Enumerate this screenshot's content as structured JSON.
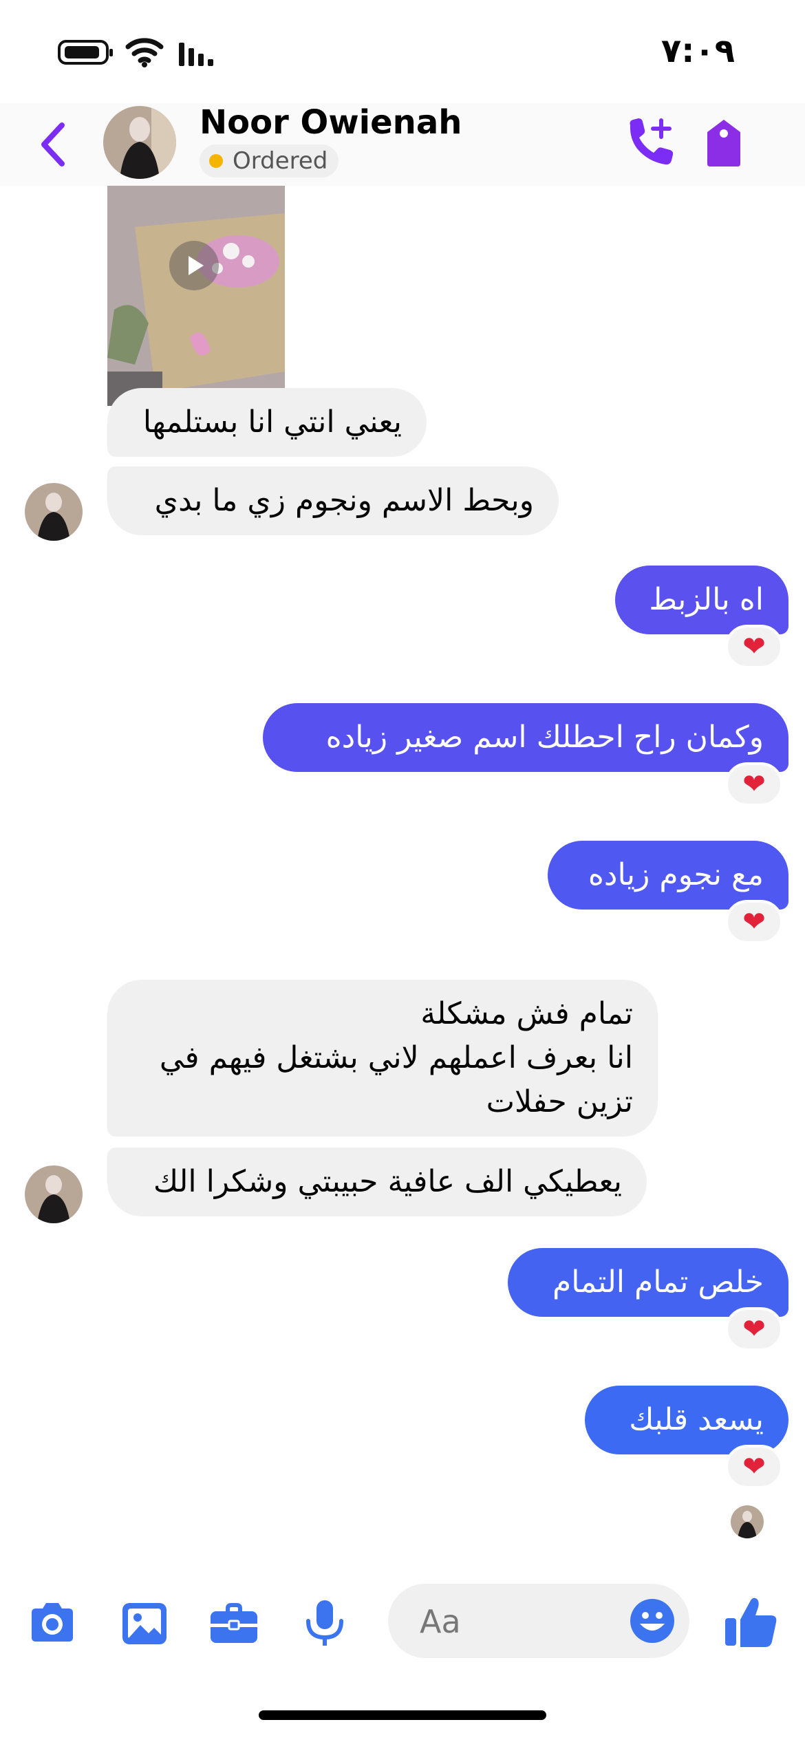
{
  "status_bar": {
    "time": "٧:٠٩",
    "icons": [
      "battery-icon",
      "wifi-icon",
      "signal-icon"
    ]
  },
  "header": {
    "contact_name": "Noor Owienah",
    "status_label": "Ordered",
    "icons": [
      "back-chevron-icon",
      "add-call-icon",
      "tag-icon"
    ]
  },
  "colors": {
    "accent": "#7b2cf5",
    "outgoing_gradient_start": "#5b50f0",
    "outgoing_gradient_end": "#3b6cf2",
    "incoming": "#f0f0f0",
    "status_dot": "#f5b400"
  },
  "messages": [
    {
      "id": "m1",
      "direction": "in",
      "type": "video"
    },
    {
      "id": "m2",
      "direction": "in",
      "text": "يعني انتي انا بستلمها"
    },
    {
      "id": "m3",
      "direction": "in",
      "text": "وبحط الاسم ونجوم زي ما بدي"
    },
    {
      "id": "m4",
      "direction": "out",
      "text": "اه بالزبط",
      "reaction": "❤"
    },
    {
      "id": "m5",
      "direction": "out",
      "text": "وكمان راح احطلك اسم  صغير زياده",
      "reaction": "❤"
    },
    {
      "id": "m6",
      "direction": "out",
      "text": "مع نجوم زياده",
      "reaction": "❤"
    },
    {
      "id": "m7",
      "direction": "in",
      "text": "تمام فش مشكلة\nانا بعرف اعملهم لاني بشتغل فيهم في\nتزين حفلات"
    },
    {
      "id": "m8",
      "direction": "in",
      "text": "يعطيكي الف عافية حبيبتي وشكرا الك"
    },
    {
      "id": "m9",
      "direction": "out",
      "text": "خلص تمام التمام",
      "reaction": "❤"
    },
    {
      "id": "m10",
      "direction": "out",
      "text": "يسعد قلبك",
      "reaction": "❤"
    }
  ],
  "composer": {
    "placeholder": "Aa",
    "icons": [
      "camera-icon",
      "photo-icon",
      "briefcase-icon",
      "microphone-icon",
      "emoji-icon",
      "thumbs-up-icon"
    ]
  }
}
